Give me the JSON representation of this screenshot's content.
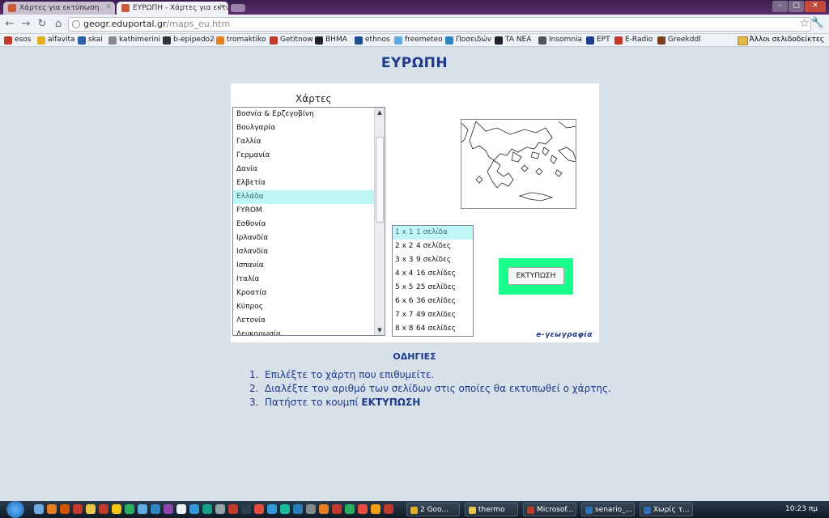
{
  "browser": {
    "tabs": [
      {
        "label": "Χάρτες για εκτύπωση"
      },
      {
        "label": "ΕΥΡΩΠΗ - Χάρτες για εκτύπ"
      }
    ],
    "url_host": "geogr.eduportal.gr",
    "url_path": "/maps_eu.htm",
    "bookmarks": [
      {
        "label": "esos",
        "color": "#c0392b"
      },
      {
        "label": "alfavita",
        "color": "#e0b020"
      },
      {
        "label": "skai",
        "color": "#2d5fa8"
      },
      {
        "label": "kathimerini",
        "color": "#888888"
      },
      {
        "label": "b-epipedo2",
        "color": "#333333"
      },
      {
        "label": "tromaktiko",
        "color": "#e67e22"
      },
      {
        "label": "Getitnow",
        "color": "#c0392b"
      },
      {
        "label": "ΒΗΜΑ",
        "color": "#222222"
      },
      {
        "label": "ethnos",
        "color": "#1d4f91"
      },
      {
        "label": "freemeteo",
        "color": "#5dade2"
      },
      {
        "label": "Ποσειδών",
        "color": "#2e86c1"
      },
      {
        "label": "TA NEA",
        "color": "#222222"
      },
      {
        "label": "Insomnia",
        "color": "#555555"
      },
      {
        "label": "ΕΡΤ",
        "color": "#1f3a93"
      },
      {
        "label": "E-Radio",
        "color": "#c0392b"
      },
      {
        "label": "Greekddl",
        "color": "#7b3f1f"
      }
    ],
    "other_bookmarks": "Άλλοι σελιδοδείκτες"
  },
  "page": {
    "title": "ΕΥΡΩΠΗ",
    "maps_heading": "Χάρτες",
    "maps": [
      "Βοσνία & Ερζεγοβίνη",
      "Βουλγαρία",
      "Γαλλία",
      "Γερμανία",
      "Δανία",
      "Ελβετία",
      "Ελλάδα",
      "FYROM",
      "Εσθονία",
      "Ιρλανδία",
      "Ισλανδία",
      "Ισπανία",
      "Ιταλία",
      "Κροατία",
      "Κύπρος",
      "Λετονία",
      "Λευκορωσία"
    ],
    "selected_map": "Ελλάδα",
    "page_options": [
      {
        "grid": "1 x 1",
        "pages": "1 σελίδα"
      },
      {
        "grid": "2 x 2",
        "pages": "4 σελίδες"
      },
      {
        "grid": "3 x 3",
        "pages": "9 σελίδες"
      },
      {
        "grid": "4 x 4",
        "pages": "16 σελίδες"
      },
      {
        "grid": "5 x 5",
        "pages": "25 σελίδες"
      },
      {
        "grid": "6 x 6",
        "pages": "36 σελίδες"
      },
      {
        "grid": "7 x 7",
        "pages": "49 σελίδες"
      },
      {
        "grid": "8 x 8",
        "pages": "64 σελίδες"
      }
    ],
    "selected_page_option": "1 x 1",
    "print_button": "ΕΚΤΥΠΩΣΗ",
    "brand": "e-γεωγραφία",
    "instructions_heading": "ΟΔΗΓΙΕΣ",
    "instructions": [
      {
        "num": "1.",
        "text": "Επιλέξτε το χάρτη που επιθυμείτε.",
        "bold": ""
      },
      {
        "num": "2.",
        "text": "Διαλέξτε τον αριθμό των σελίδων στις οποίες θα εκτυπωθεί ο χάρτης.",
        "bold": ""
      },
      {
        "num": "3.",
        "text": "Πατήστε το κουμπί ",
        "bold": "ΕΚΤΥΠΩΣΗ"
      }
    ]
  },
  "taskbar": {
    "tasks": [
      {
        "label": "2 Goo...",
        "color": "#e0b020"
      },
      {
        "label": "thermo",
        "color": "#e6c34a"
      },
      {
        "label": "Microsof...",
        "color": "#c0392b"
      },
      {
        "label": "senario_...",
        "color": "#2d6fb8"
      },
      {
        "label": "Χωρίς τ...",
        "color": "#2d6fb8"
      }
    ],
    "clock": "10:23 πμ"
  }
}
